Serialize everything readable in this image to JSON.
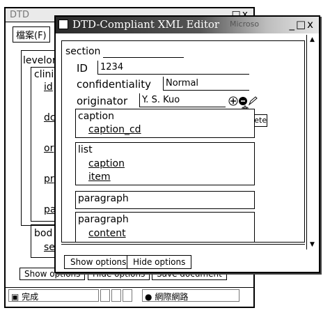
{
  "back_window": {
    "title": "DTD",
    "menu_label": "檔案(F)",
    "level_label": "levelor",
    "inner_label": "clini",
    "links": [
      "id",
      "dc",
      "or",
      "pr",
      "pa"
    ],
    "body_label": "bod",
    "body_link": "se",
    "buttons": [
      "Show options",
      "Hide options",
      "Save document"
    ],
    "status": {
      "left": "完成",
      "right": "網際網路"
    }
  },
  "front_window": {
    "title": "DTD-Compliant XML Editor",
    "title_suffix": "Microso",
    "section_label": "section",
    "fields": {
      "id": {
        "label": "ID",
        "value": "1234"
      },
      "confidentiality": {
        "label": "confidentiality",
        "value": "Normal"
      },
      "originator": {
        "label": "originator",
        "value": "Y. S. Kuo"
      }
    },
    "tooltip": "Delete",
    "boxes": {
      "caption": {
        "title": "caption",
        "link": "caption_cd"
      },
      "list": {
        "title": "list",
        "links": [
          "caption",
          "item"
        ]
      },
      "paragraph1": {
        "title": "paragraph"
      },
      "paragraph2": {
        "title": "paragraph",
        "link": "content"
      }
    },
    "buttons": [
      "Show options",
      "Hide options"
    ]
  }
}
